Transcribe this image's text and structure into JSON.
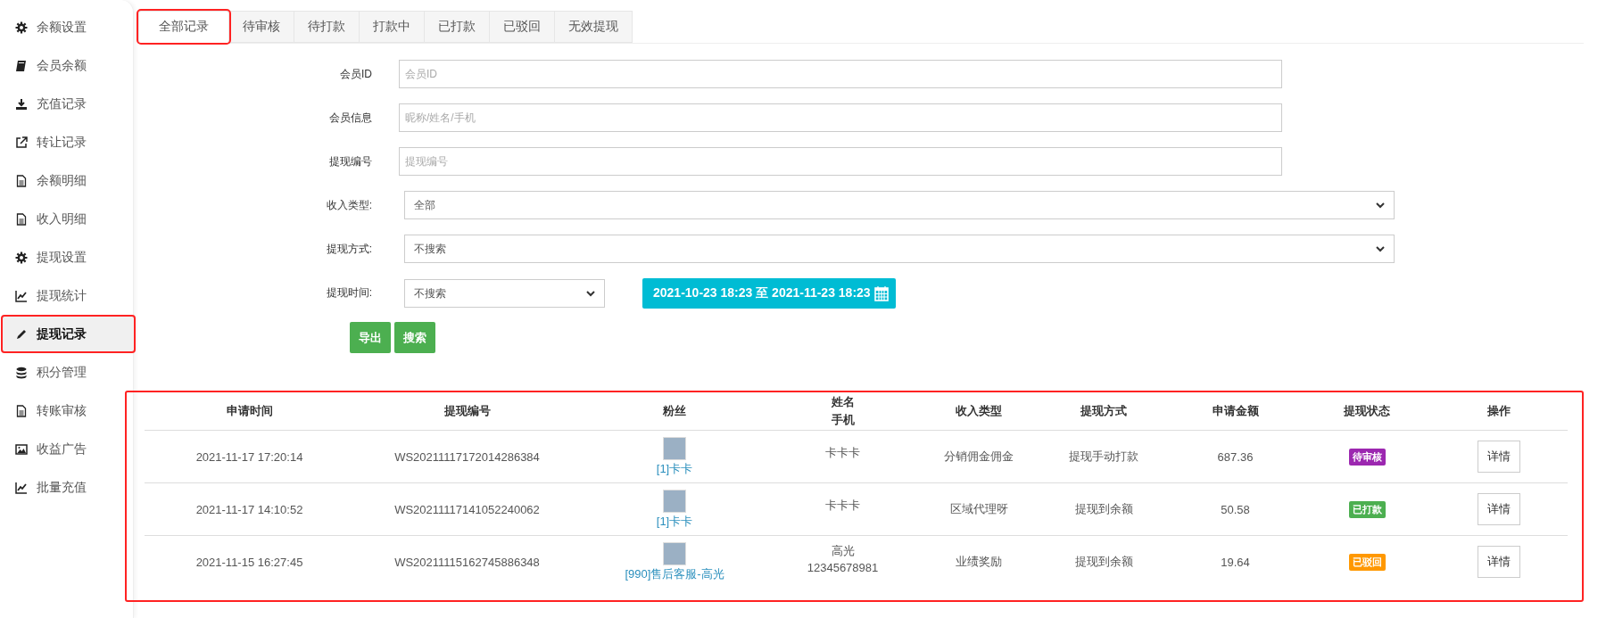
{
  "sidebar": {
    "items": [
      {
        "label": "余额设置",
        "selected": false,
        "highlighted": false
      },
      {
        "label": "会员余额",
        "selected": false,
        "highlighted": false
      },
      {
        "label": "充值记录",
        "selected": false,
        "highlighted": false
      },
      {
        "label": "转让记录",
        "selected": false,
        "highlighted": false
      },
      {
        "label": "余额明细",
        "selected": false,
        "highlighted": false
      },
      {
        "label": "收入明细",
        "selected": false,
        "highlighted": false
      },
      {
        "label": "提现设置",
        "selected": false,
        "highlighted": false
      },
      {
        "label": "提现统计",
        "selected": false,
        "highlighted": false
      },
      {
        "label": "提现记录",
        "selected": true,
        "highlighted": true
      },
      {
        "label": "积分管理",
        "selected": false,
        "highlighted": false
      },
      {
        "label": "转账审核",
        "selected": false,
        "highlighted": false
      },
      {
        "label": "收益广告",
        "selected": false,
        "highlighted": false
      },
      {
        "label": "批量充值",
        "selected": false,
        "highlighted": false
      }
    ]
  },
  "tabs": [
    {
      "label": "全部记录",
      "selected": true,
      "highlighted": true
    },
    {
      "label": "待审核",
      "selected": false,
      "highlighted": false
    },
    {
      "label": "待打款",
      "selected": false,
      "highlighted": false
    },
    {
      "label": "打款中",
      "selected": false,
      "highlighted": false
    },
    {
      "label": "已打款",
      "selected": false,
      "highlighted": false
    },
    {
      "label": "已驳回",
      "selected": false,
      "highlighted": false
    },
    {
      "label": "无效提现",
      "selected": false,
      "highlighted": false
    }
  ],
  "filters": [
    {
      "kind": "text",
      "label": "会员ID",
      "placeholder": "会员ID"
    },
    {
      "kind": "text",
      "label": "会员信息",
      "placeholder": "昵称/姓名/手机"
    },
    {
      "kind": "text",
      "label": "提现编号",
      "placeholder": "提现编号"
    },
    {
      "kind": "select",
      "label": "收入类型:",
      "value": "全部"
    },
    {
      "kind": "select",
      "label": "提现方式:",
      "value": "不搜索"
    },
    {
      "kind": "daterange",
      "label": "提现时间:",
      "value": "不搜索",
      "range": "2021-10-23 18:23 至 2021-11-23 18:23"
    }
  ],
  "actions": [
    "导出",
    "搜索"
  ],
  "table": {
    "highlighted": true,
    "columns": [
      {
        "label": "申请时间"
      },
      {
        "label": "提现编号"
      },
      {
        "label": "粉丝"
      },
      {
        "label": "姓名",
        "sublabel": "手机"
      },
      {
        "label": "收入类型"
      },
      {
        "label": "提现方式"
      },
      {
        "label": "申请金额"
      },
      {
        "label": "提现状态"
      },
      {
        "label": "操作"
      }
    ],
    "rows": [
      {
        "time": "2021-11-17 17:20:14",
        "number": "WS20211117172014286384",
        "fan": "[1]卡卡",
        "name": "卡卡卡",
        "income_type": "分销佣金佣金",
        "method": "提现手动打款",
        "amount": "687.36",
        "status": "待审核",
        "color": "#9c27b0",
        "action": "详情"
      },
      {
        "time": "2021-11-17 14:10:52",
        "number": "WS20211117141052240062",
        "fan": "[1]卡卡",
        "name": "卡卡卡",
        "income_type": "区域代理呀",
        "method": "提现到余额",
        "amount": "50.58",
        "status": "已打款",
        "color": "#4caf50",
        "action": "详情"
      },
      {
        "time": "2021-11-15 16:27:45",
        "number": "WS20211115162745886348",
        "fan": "[990]售后客服-高光",
        "name": "高光",
        "phone": "12345678981",
        "income_type": "业绩奖励",
        "method": "提现到余额",
        "amount": "19.64",
        "status": "已驳回",
        "color": "#ff9800",
        "action": "详情"
      }
    ]
  }
}
